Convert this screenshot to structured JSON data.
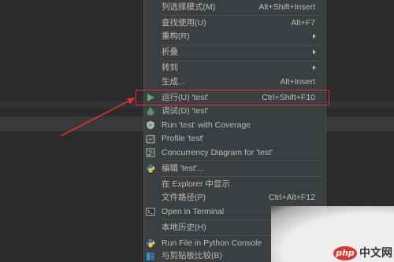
{
  "context_menu": {
    "items": [
      {
        "label": "列选择模式(M)",
        "shortcut": "Alt+Shift+Insert"
      },
      {
        "label": "查找使用(U)",
        "shortcut": "Alt+F7"
      },
      {
        "label": "重构(R)",
        "has_submenu": true
      },
      {
        "label": "折叠",
        "has_submenu": true
      },
      {
        "label": "转到",
        "has_submenu": true
      },
      {
        "label": "生成...",
        "shortcut": "Alt+Insert"
      },
      {
        "label": "运行(U) 'test'",
        "shortcut": "Ctrl+Shift+F10",
        "icon": "run-icon",
        "highlighted": true
      },
      {
        "label": "调试(D) 'test'",
        "icon": "debug-icon"
      },
      {
        "label": "Run 'test' with Coverage",
        "icon": "coverage-icon"
      },
      {
        "label": "Profile 'test'",
        "icon": "profile-icon"
      },
      {
        "label": "Concurrency Diagram for 'test'",
        "icon": "concurrency-diagram-icon"
      },
      {
        "label": "编辑 'test'...",
        "icon": "python-icon"
      },
      {
        "label": "在 Explorer 中显示"
      },
      {
        "label": "文件路径(P)",
        "shortcut": "Ctrl+Alt+F12"
      },
      {
        "label": "Open in Terminal",
        "icon": "terminal-icon"
      },
      {
        "label": "本地历史(H)",
        "has_submenu": true
      },
      {
        "label": "Run File in Python Console",
        "icon": "python-icon"
      },
      {
        "label": "与剪贴板比较(B)",
        "icon": "compare-icon"
      }
    ]
  },
  "watermark": {
    "logo_text": "php",
    "site_text": "中文网"
  },
  "colors": {
    "editor_bg": "#2b2b2b",
    "menu_bg": "#3c3f41",
    "menu_text": "#bbbbbb",
    "annotation_red": "#e0302b",
    "run_green": "#59a869"
  }
}
